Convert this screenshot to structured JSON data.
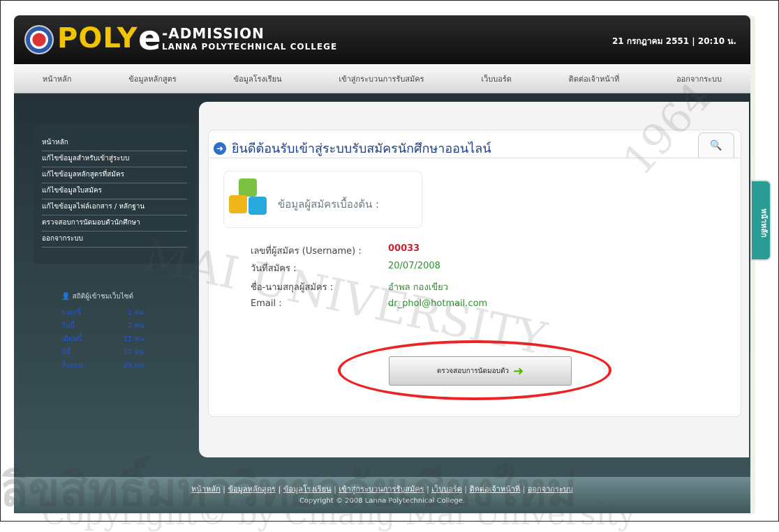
{
  "header": {
    "logo_brand": "POLY",
    "logo_e": "e",
    "logo_suffix": "-ADMISSION",
    "logo_sub": "LANNA POLYTECHNICAL COLLEGE",
    "datetime": "21 กรกฎาคม 2551  |  20:10 น."
  },
  "nav": {
    "items": [
      "หน้าหลัก",
      "ข้อมูลหลักสูตร",
      "ข้อมูลโรงเรียน",
      "เข้าสู่กระบวนการรับสมัคร",
      "เว็บบอร์ด",
      "ติดต่อเจ้าหน้าที่",
      "ออกจากระบบ"
    ]
  },
  "sidebar": {
    "items": [
      "หน้าหลัก",
      "แก้ไขข้อมูลสำหรับเข้าสู่ระบบ",
      "แก้ไขข้อมูลหลักสูตรที่สมัคร",
      "แก้ไขข้อมูลใบสมัคร",
      "แก้ไขข้อมูลไฟล์เอกสาร / หลักฐาน",
      "ตรวจสอบการนัดมอบตัวนักศึกษา",
      "ออกจากระบบ"
    ]
  },
  "stats": {
    "title": "สถิติผู้เข้าชมเว็บไซต์",
    "rows": [
      {
        "label": "ขณะนี้",
        "value": "1 คน"
      },
      {
        "label": "วันนี้",
        "value": "2 คน"
      },
      {
        "label": "เดือนนี้",
        "value": "11 คน"
      },
      {
        "label": "ปีนี้",
        "value": "12 คน"
      },
      {
        "label": "ทั้งหมด",
        "value": "29 คน"
      }
    ]
  },
  "main": {
    "title": "ยินดีต้อนรับเข้าสู่ระบบรับสมัครนักศึกษาออนไลน์",
    "info_label": "ข้อมูลผู้สมัครเบื้องต้น :",
    "fields": [
      {
        "label": "เลขที่ผู้สมัคร (Username) :",
        "value": "00033"
      },
      {
        "label": "วันที่สมัคร :",
        "value": "20/07/2008"
      },
      {
        "label": "ชื่อ-นามสกุลผู้สมัคร :",
        "value": "อำพล  กองเขียว"
      },
      {
        "label": "Email :",
        "value": "dr_phol@hotmail.com"
      }
    ],
    "button": "ตรวจสอบการนัดมอบตัว"
  },
  "side_tab": "หน้าหลัก",
  "footer": {
    "links": [
      "หน้าหลัก",
      "ข้อมูลหลักสูตร",
      "ข้อมูลโรงเรียน",
      "เข้าสู่กระบวนการรับสมัคร",
      "เว็บบอร์ด",
      "ติดต่อเจ้าหน้าที่",
      "ออกจากระบบ"
    ],
    "copyright": "Copyright © 2008 Lanna Polytechnical College."
  },
  "watermark": {
    "university": "MAI UNIVERSITY",
    "year": "1964",
    "thai": "ลิขสิทธิ์มหาวิทยาลัยเชียงใหม่",
    "copyright": "Copyright© by Chiang Mai University"
  },
  "colors": {
    "accent": "#1f3e86",
    "highlight": "#e22222",
    "value_green": "#2f8f2f"
  }
}
